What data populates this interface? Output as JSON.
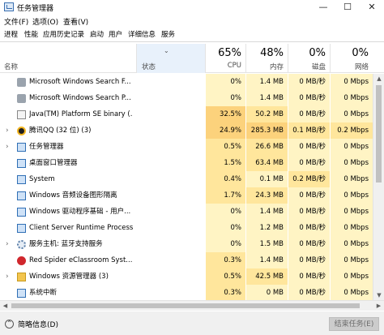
{
  "window": {
    "title": "任务管理器",
    "minimize_glyph": "—",
    "maximize_glyph": "☐",
    "close_glyph": "✕"
  },
  "menu": [
    "文件(F)",
    "选项(O)",
    "查看(V)"
  ],
  "tabs": [
    "进程",
    "性能",
    "应用历史记录",
    "启动",
    "用户",
    "详细信息",
    "服务"
  ],
  "header": {
    "name_label": "名称",
    "status_label": "状态",
    "sort_glyph": "⌄",
    "cpu_pct": "65%",
    "cpu_label": "CPU",
    "mem_pct": "48%",
    "mem_label": "内存",
    "disk_pct": "0%",
    "disk_label": "磁盘",
    "net_pct": "0%",
    "net_label": "网络"
  },
  "rows": [
    {
      "expander": "",
      "icon": "search-icon",
      "name": "Microsoft Windows Search F...",
      "cpu": "0%",
      "mem": "1.4 MB",
      "disk": "0 MB/秒",
      "net": "0 Mbps"
    },
    {
      "expander": "",
      "icon": "search-icon",
      "name": "Microsoft Windows Search P...",
      "cpu": "0%",
      "mem": "1.4 MB",
      "disk": "0 MB/秒",
      "net": "0 Mbps"
    },
    {
      "expander": "",
      "icon": "java-icon",
      "name": "Java(TM) Platform SE binary (...",
      "cpu": "32.5%",
      "mem": "50.2 MB",
      "disk": "0 MB/秒",
      "net": "0 Mbps"
    },
    {
      "expander": "›",
      "icon": "qq-icon",
      "name": "腾讯QQ (32 位) (3)",
      "cpu": "24.9%",
      "mem": "285.3 MB",
      "disk": "0.1 MB/秒",
      "net": "0.2 Mbps"
    },
    {
      "expander": "›",
      "icon": "task-manager-icon",
      "name": "任务管理器",
      "cpu": "0.5%",
      "mem": "26.6 MB",
      "disk": "0 MB/秒",
      "net": "0 Mbps"
    },
    {
      "expander": "",
      "icon": "window-icon",
      "name": "桌面窗口管理器",
      "cpu": "1.5%",
      "mem": "63.4 MB",
      "disk": "0 MB/秒",
      "net": "0 Mbps"
    },
    {
      "expander": "",
      "icon": "window-icon",
      "name": "System",
      "cpu": "0.4%",
      "mem": "0.1 MB",
      "disk": "0.2 MB/秒",
      "net": "0 Mbps"
    },
    {
      "expander": "",
      "icon": "window-icon",
      "name": "Windows 音频设备图形隔离",
      "cpu": "1.7%",
      "mem": "24.3 MB",
      "disk": "0 MB/秒",
      "net": "0 Mbps"
    },
    {
      "expander": "",
      "icon": "window-icon",
      "name": "Windows 驱动程序基础 - 用户...",
      "cpu": "0%",
      "mem": "1.4 MB",
      "disk": "0 MB/秒",
      "net": "0 Mbps"
    },
    {
      "expander": "",
      "icon": "window-icon",
      "name": "Client Server Runtime Process",
      "cpu": "0%",
      "mem": "1.2 MB",
      "disk": "0 MB/秒",
      "net": "0 Mbps"
    },
    {
      "expander": "›",
      "icon": "gear-icon",
      "name": "服务主机: 蓝牙支持服务",
      "cpu": "0%",
      "mem": "1.5 MB",
      "disk": "0 MB/秒",
      "net": "0 Mbps"
    },
    {
      "expander": "",
      "icon": "red-spider-icon",
      "name": "Red Spider eClassroom Syst...",
      "cpu": "0.3%",
      "mem": "1.4 MB",
      "disk": "0 MB/秒",
      "net": "0 Mbps"
    },
    {
      "expander": "›",
      "icon": "folder-icon",
      "name": "Windows 资源管理器 (3)",
      "cpu": "0.5%",
      "mem": "42.5 MB",
      "disk": "0 MB/秒",
      "net": "0 Mbps"
    },
    {
      "expander": "",
      "icon": "window-icon",
      "name": "系统中断",
      "cpu": "0.3%",
      "mem": "0 MB",
      "disk": "0 MB/秒",
      "net": "0 Mbps"
    }
  ],
  "footer": {
    "fewer_details": "简略信息(D)",
    "fewer_glyph": "⌃",
    "end_task": "结束任务(E)"
  },
  "colors": {
    "heat_light": "#fff4c4",
    "heat_mid": "#ffe69c",
    "heat_strong": "#fcd27c",
    "status_column": "#e8f1fb",
    "footer_bg": "#f0f0f0"
  }
}
